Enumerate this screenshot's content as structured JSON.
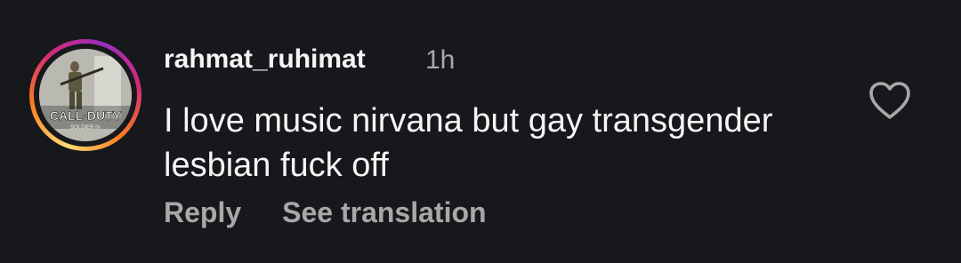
{
  "comment": {
    "username": "rahmat_ruhimat",
    "time": "1h",
    "text": "I love music nirvana but gay transgender lesbian fuck off",
    "actions": {
      "reply": "Reply",
      "see_translation": "See translation"
    },
    "avatar": {
      "logo_text": "CALL·DUTY",
      "logo_subtext": "SOLDIER IV"
    }
  },
  "icons": {
    "like": "heart-outline-icon"
  },
  "colors": {
    "background": "#16181c",
    "primary_text": "#f5f5f5",
    "secondary_text": "#a8a8a8"
  }
}
